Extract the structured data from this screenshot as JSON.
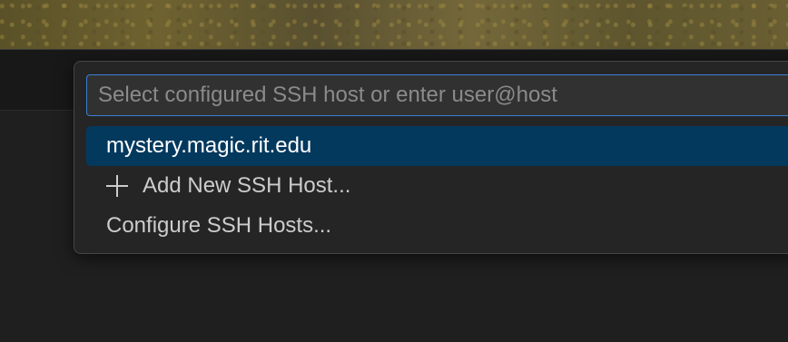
{
  "quick_pick": {
    "placeholder": "Select configured SSH host or enter user@host",
    "value": "",
    "items": [
      {
        "label": "mystery.magic.rit.edu",
        "icon": null,
        "selected": true
      },
      {
        "label": "Add New SSH Host...",
        "icon": "plus-icon",
        "selected": false
      },
      {
        "label": "Configure SSH Hosts...",
        "icon": null,
        "selected": false
      }
    ]
  },
  "colors": {
    "selection": "#04395e",
    "focus_border": "#3b7fd4",
    "panel": "#252526"
  }
}
